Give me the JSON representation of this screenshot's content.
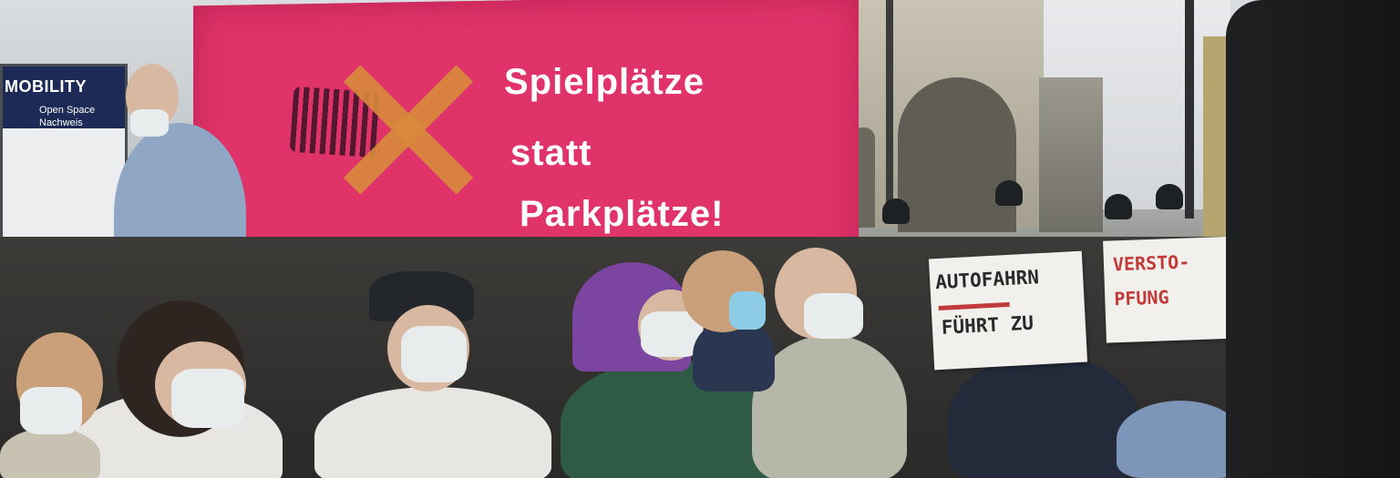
{
  "banner": {
    "line1": "Spielplätze",
    "line2": "statt",
    "line3": "Parkplätze!",
    "color": "#e0336a"
  },
  "left_sign": {
    "title": "MOBILITY",
    "subtitle": "Open Space",
    "subtitle2": "Nachweis"
  },
  "sign_a": {
    "line1": "AUTOFAHRN",
    "line2": "FÜHRT ZU"
  },
  "sign_b": {
    "line1": "VERSTO-",
    "line2": "PFUNG"
  }
}
